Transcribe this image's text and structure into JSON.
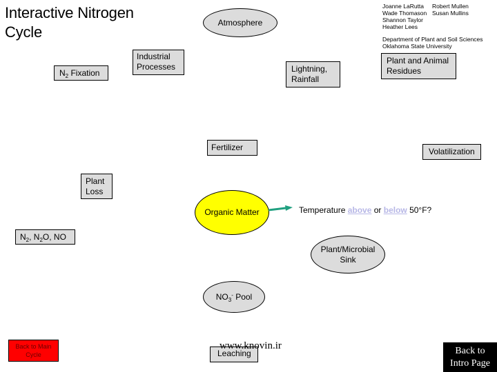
{
  "page": {
    "title": "Interactive Nitrogen Cycle",
    "title_line1": "Interactive Nitrogen",
    "title_line2": "Cycle"
  },
  "credits": {
    "authors_col1": [
      "Joanne LaRutta",
      "Wade Thomason",
      "Shannon Taylor",
      "Heather Lees"
    ],
    "authors_col2": [
      "Robert Mullen",
      "Susan Mullins"
    ],
    "department": "Department of Plant and Soil Sciences",
    "university": "Oklahoma State University"
  },
  "nodes": {
    "atmosphere": "Atmosphere",
    "n2_fixation": {
      "base": "N",
      "sub": "2",
      "rest": " Fixation"
    },
    "industrial_processes": [
      "Industrial",
      "Processes"
    ],
    "lightning_rainfall": [
      "Lightning,",
      "Rainfall"
    ],
    "plant_animal_residues": [
      "Plant and Animal",
      "Residues"
    ],
    "fertilizer": "Fertilizer",
    "volatilization": "Volatilization",
    "plant_loss": [
      "Plant",
      "Loss"
    ],
    "organic_matter": "Organic Matter",
    "gases": {
      "n2": "N",
      "n2_sub": "2",
      "sep1": ", N",
      "n2o_sub": "2",
      "rest": "O, NO"
    },
    "plant_microbial_sink": [
      "Plant/Microbial",
      "Sink"
    ],
    "no3_pool": {
      "base": "NO",
      "sub": "3",
      "sup": "-",
      "rest": " Pool"
    },
    "leaching": "Leaching"
  },
  "temperature_question": {
    "prefix": "Temperature ",
    "above_link": "above",
    "middle": " or ",
    "below_link": "below",
    "suffix": " 50°F?"
  },
  "buttons": {
    "back_main_line1": "Back to Main",
    "back_main_line2": "Cycle",
    "back_intro_line1": "Back to",
    "back_intro_line2": "Intro Page"
  },
  "watermark": "www.knovin.ir",
  "colors": {
    "box_fill": "#dcdcdc",
    "organic_matter_fill": "#ffff00",
    "arrow": "#20a080",
    "link": "#b7b7e6",
    "back_main_fill": "#ff0000",
    "back_intro_fill": "#000000"
  }
}
